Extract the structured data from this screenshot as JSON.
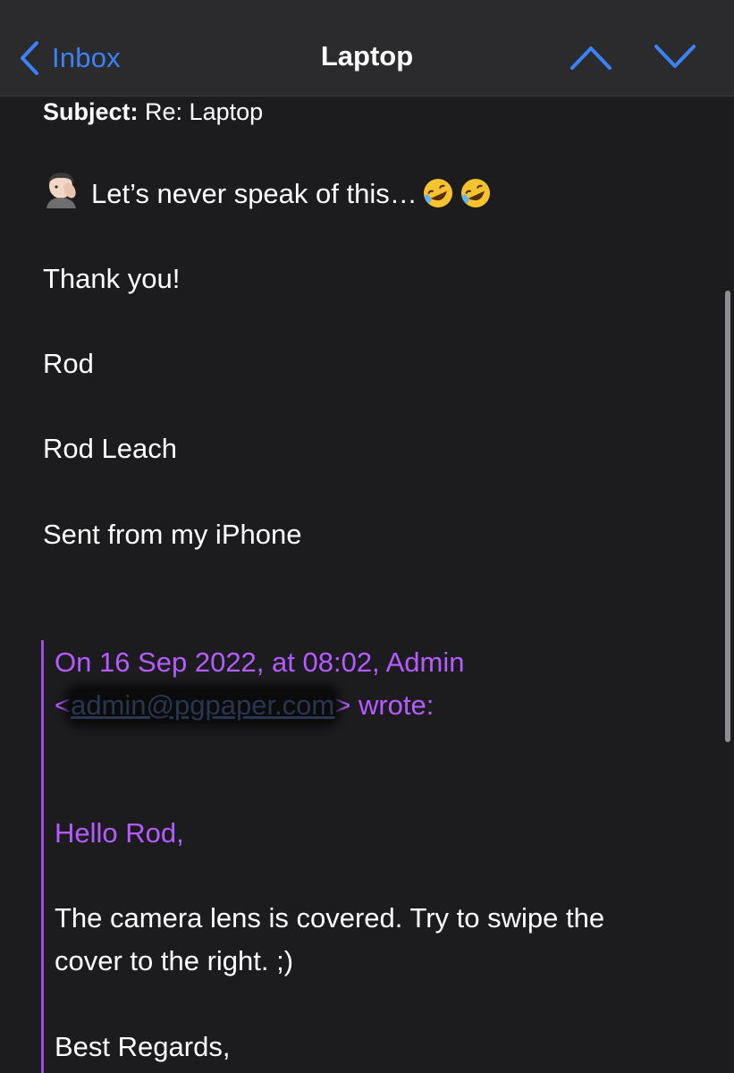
{
  "nav": {
    "back_label": "Inbox",
    "title": "Laptop"
  },
  "email": {
    "subject_label": "Subject:",
    "subject_value": "Re: Laptop",
    "first_line": "Let’s never speak of this…",
    "lines": [
      "Thank you!",
      "Rod",
      "Rod Leach",
      "Sent from my iPhone"
    ]
  },
  "quoted": {
    "header_line1": "On 16 Sep 2022, at 08:02, Admin",
    "email_open": "<",
    "email_address": "admin@pgpaper.com",
    "header_line2_tail": "> wrote:",
    "greeting": "Hello Rod,",
    "body_line1": "The camera lens is covered. Try to swipe the",
    "body_line2": "cover to the right. ;)",
    "signoff": "Best Regards,"
  },
  "colors": {
    "accent": "#3b82f6",
    "quote": "#b45cff",
    "background": "#1c1c1e"
  },
  "icons": [
    "chevron-left-icon",
    "chevron-up-icon",
    "chevron-down-icon",
    "facepalm-emoji",
    "rofl-emoji"
  ]
}
